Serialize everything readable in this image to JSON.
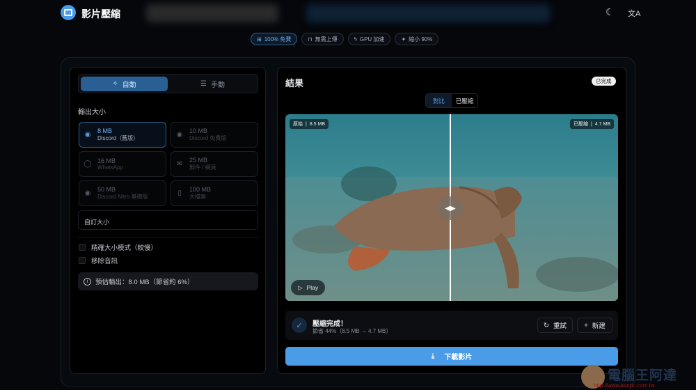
{
  "header": {
    "app_title": "影片壓縮",
    "theme_icon": "moon-icon",
    "language_icon": "translate-icon"
  },
  "pills": [
    {
      "icon": "gift-icon",
      "label": "100% 免費"
    },
    {
      "icon": "lock-icon",
      "label": "無需上傳"
    },
    {
      "icon": "bolt-icon",
      "label": "GPU 加速"
    },
    {
      "icon": "sparkle-icon",
      "label": "縮小 90%"
    }
  ],
  "left": {
    "mode_auto": "自動",
    "mode_manual": "手動",
    "output_size_label": "輸出大小",
    "presets": [
      {
        "size": "8 MB",
        "desc": "Discord（舊版）",
        "icon": "discord-icon",
        "selected": true
      },
      {
        "size": "10 MB",
        "desc": "Discord 免費版",
        "icon": "discord-icon"
      },
      {
        "size": "16 MB",
        "desc": "WhatsApp",
        "icon": "whatsapp-icon"
      },
      {
        "size": "25 MB",
        "desc": "郵件 / 網頁",
        "icon": "mail-icon"
      },
      {
        "size": "50 MB",
        "desc": "Discord Nitro 基礎版",
        "icon": "discord-icon"
      },
      {
        "size": "100 MB",
        "desc": "大檔案",
        "icon": "file-icon"
      }
    ],
    "custom_size": "自訂大小",
    "precise_mode": "精確大小模式（較慢）",
    "remove_audio": "移除音訊",
    "estimate": "預估輸出：8.0 MB（節省約 6%）"
  },
  "right": {
    "title": "結果",
    "status_badge": "已完成",
    "view_compare": "對比",
    "view_compressed": "已壓縮",
    "original_label": "原始",
    "original_size": "8.5 MB",
    "compressed_label": "已壓縮",
    "compressed_size": "4.7 MB",
    "play": "Play",
    "done_title": "壓縮完成！",
    "done_detail": "節省 44%（8.5 MB → 4.7 MB）",
    "retry": "重試",
    "new": "新建",
    "download": "下載影片"
  },
  "colors": {
    "accent": "#4a9be8",
    "background": "#05070b"
  },
  "watermark": {
    "name": "電腦王阿達",
    "url": "http://www.kocpc.com.tw"
  }
}
